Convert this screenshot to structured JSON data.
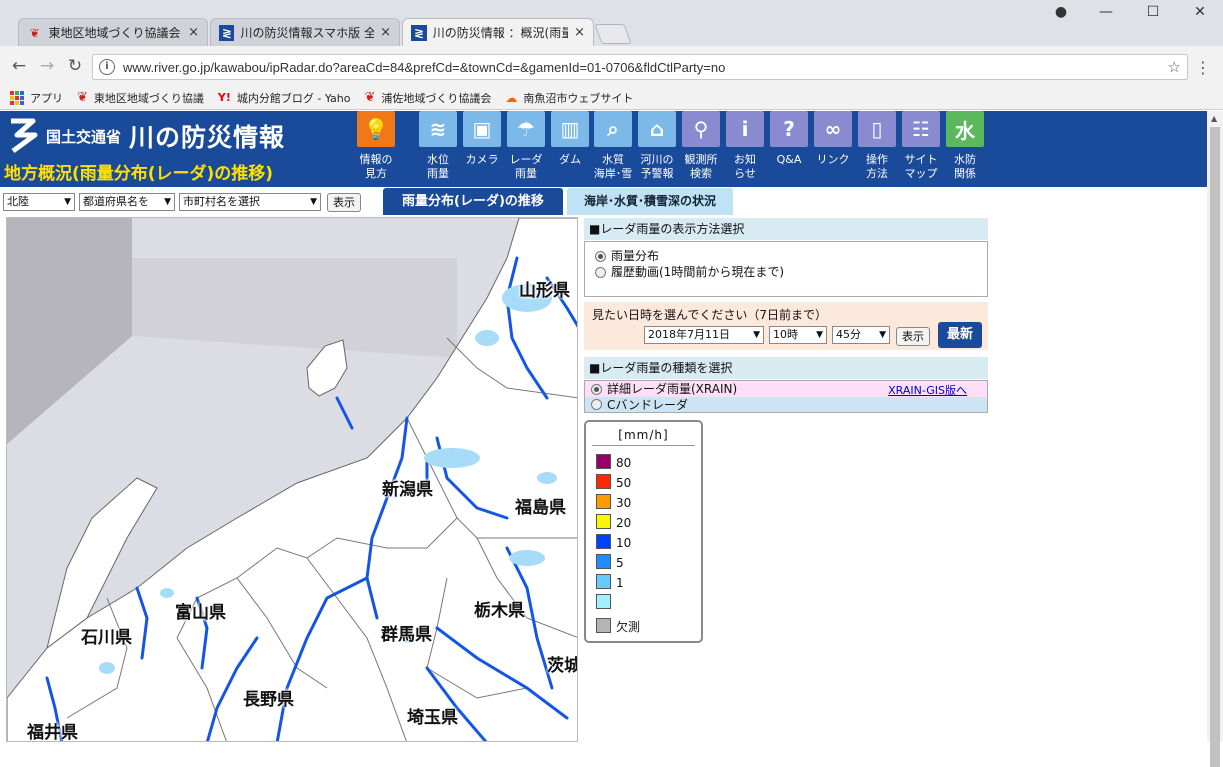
{
  "browser": {
    "tabs": [
      {
        "title": "東地区地域づくり協議会ブロ",
        "close": "×"
      },
      {
        "title": "川の防災情報スマホ版 全国",
        "close": "×"
      },
      {
        "title": "川の防災情報 ：概況(雨量",
        "close": "×"
      }
    ],
    "window_controls": {
      "minimize": "—",
      "maximize": "☐",
      "close": "✕"
    },
    "url": "www.river.go.jp/kawabou/ipRadar.do?areaCd=84&prefCd=&townCd=&gamenId=01-0706&fldCtlParty=no",
    "bookmarks": [
      "アプリ",
      "東地区地域づくり協議",
      "城内分館ブログ - Yaho",
      "浦佐地域づくり協議会",
      "南魚沼市ウェブサイト"
    ]
  },
  "site": {
    "ministry": "国土交通省",
    "name": "川の防災情報",
    "page_title": "地方概況(雨量分布(レーダ)の推移)",
    "nav": [
      {
        "label": "情報の\n見方",
        "icon": "lightbulb-icon",
        "color": "orange"
      },
      {
        "label": "水位\n雨量",
        "icon": "water-level-icon",
        "color": "blue"
      },
      {
        "label": "カメラ",
        "icon": "camera-icon",
        "color": "blue"
      },
      {
        "label": "レーダ\n雨量",
        "icon": "radar-rain-icon",
        "color": "blue"
      },
      {
        "label": "ダム",
        "icon": "dam-icon",
        "color": "blue"
      },
      {
        "label": "水質\n海岸･雪",
        "icon": "water-quality-icon",
        "color": "blue"
      },
      {
        "label": "河川の\n予警報",
        "icon": "house-warning-icon",
        "color": "blue"
      },
      {
        "label": "観測所\n検索",
        "icon": "search-icon",
        "color": "purple"
      },
      {
        "label": "お知\nらせ",
        "icon": "info-icon",
        "color": "purple"
      },
      {
        "label": "Q&A",
        "icon": "question-icon",
        "color": "purple"
      },
      {
        "label": "リンク",
        "icon": "link-icon",
        "color": "purple"
      },
      {
        "label": "操作\n方法",
        "icon": "mouse-icon",
        "color": "purple"
      },
      {
        "label": "サイト\nマップ",
        "icon": "sitemap-icon",
        "color": "purple"
      },
      {
        "label": "水防\n関係",
        "icon": "flood-defense-icon",
        "color": "green"
      }
    ]
  },
  "controls": {
    "region": "北陸",
    "prefecture": "都道府県名を",
    "town": "市町村名を選択",
    "show": "表示",
    "tab_rain": "雨量分布(レーダ)の推移",
    "tab_coast": "海岸･水質･積雪深の状況"
  },
  "map": {
    "prefectures": [
      "山形県",
      "新潟県",
      "福島県",
      "富山県",
      "石川県",
      "栃木県",
      "群馬県",
      "茨城",
      "長野県",
      "埼玉県",
      "福井県"
    ]
  },
  "panel": {
    "display_method_header": "■レーダ雨量の表示方法選択",
    "display_options": [
      "雨量分布",
      "履歴動画(1時間前から現在まで)"
    ],
    "date_prompt": "見たい日時を選んでください（7日前まで）",
    "date": "2018年7月11日",
    "hour": "10時",
    "minute": "45分",
    "show": "表示",
    "latest": "最新",
    "type_header": "■レーダ雨量の種類を選択",
    "type_options": [
      "詳細レーダ雨量(XRAIN)",
      "Cバンドレーダ"
    ],
    "xrain_gis_link": "XRAIN-GIS版へ"
  },
  "legend": {
    "unit": "[mm/h]",
    "items": [
      {
        "value": "80",
        "color": "#990066"
      },
      {
        "value": "50",
        "color": "#ff2800"
      },
      {
        "value": "30",
        "color": "#ff9900"
      },
      {
        "value": "20",
        "color": "#faf500"
      },
      {
        "value": "10",
        "color": "#0041ff"
      },
      {
        "value": "5",
        "color": "#218cff"
      },
      {
        "value": "1",
        "color": "#66ccff"
      },
      {
        "value": "",
        "color": "#a0f0ff"
      },
      {
        "value": "欠測",
        "color": "#b4b4b4"
      }
    ]
  }
}
